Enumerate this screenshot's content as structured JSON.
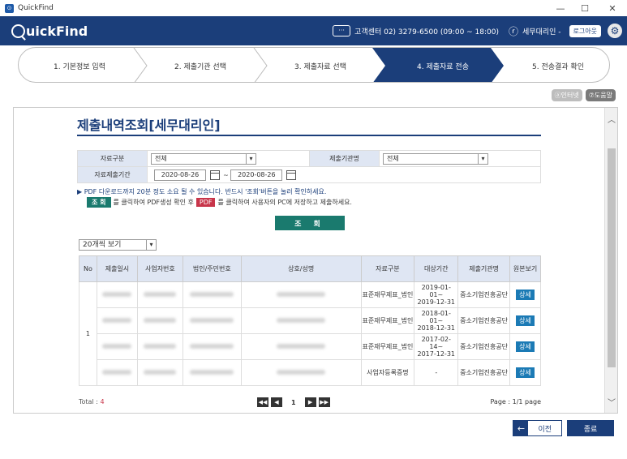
{
  "window": {
    "title": "QuickFind",
    "minimize": "—",
    "maximize": "☐",
    "close": "✕"
  },
  "header": {
    "logo_text": "uickFind",
    "call_center": "고객센터 02) 3279-6500 (09:00 ~ 18:00)",
    "user_name": "세무대리인 -",
    "logout_label": "로그아웃"
  },
  "steps": [
    {
      "label": "1. 기본정보 입력",
      "active": false
    },
    {
      "label": "2. 제출기관 선택",
      "active": false
    },
    {
      "label": "3. 제출자료 선택",
      "active": false
    },
    {
      "label": "4. 제출자료 전송",
      "active": true
    },
    {
      "label": "5. 전송결과 확인",
      "active": false
    }
  ],
  "top_buttons": {
    "print": "인터넷",
    "help": "도움말"
  },
  "page": {
    "title": "제출내역조회[세무대리인]"
  },
  "form": {
    "data_type_label": "자료구분",
    "data_type_value": "전체",
    "agency_label": "제출기관명",
    "agency_value": "전체",
    "period_label": "자료제출기간",
    "date_from": "2020-08-26",
    "date_sep": "~",
    "date_to": "2020-08-26"
  },
  "notice": {
    "line1": "▶ PDF 다운로드까지 20분 정도 소요 될 수 있습니다. 반드시 '조회'버튼을 눌러 확인하세요.",
    "search_tag": "조 회",
    "line2a": "를 클릭하여 PDF생성 확인 후",
    "pdf_tag": "PDF",
    "line2b": "를 클릭하여 사용자의 PC에 저장하고 제출하세요."
  },
  "search_button": "조 회",
  "page_size": "20개씩 보기",
  "table": {
    "headers": [
      "No",
      "제출일시",
      "사업자번호",
      "법인/주민번호",
      "상호/성명",
      "자료구분",
      "대상기간",
      "제출기관명",
      "원본보기"
    ],
    "group_no": "1",
    "rows": [
      {
        "type": "표준재무제표_법인",
        "period_from": "2019-01-01~",
        "period_to": "2019-12-31",
        "agency": "중소기업진흥공단",
        "action": "상세"
      },
      {
        "type": "표준재무제표_법인",
        "period_from": "2018-01-01~",
        "period_to": "2018-12-31",
        "agency": "중소기업진흥공단",
        "action": "상세"
      },
      {
        "type": "표준재무제표_법인",
        "period_from": "2017-02-14~",
        "period_to": "2017-12-31",
        "agency": "중소기업진흥공단",
        "action": "상세"
      },
      {
        "type": "사업자등록증명",
        "period_from": "-",
        "period_to": "",
        "agency": "중소기업진흥공단",
        "action": "상세"
      }
    ]
  },
  "footer": {
    "total_label": "Total : ",
    "total_count": "4",
    "page_current": "1",
    "page_info": "Page : 1/1 page"
  },
  "bottom_buttons": {
    "prev": "이전",
    "end": "종료"
  }
}
